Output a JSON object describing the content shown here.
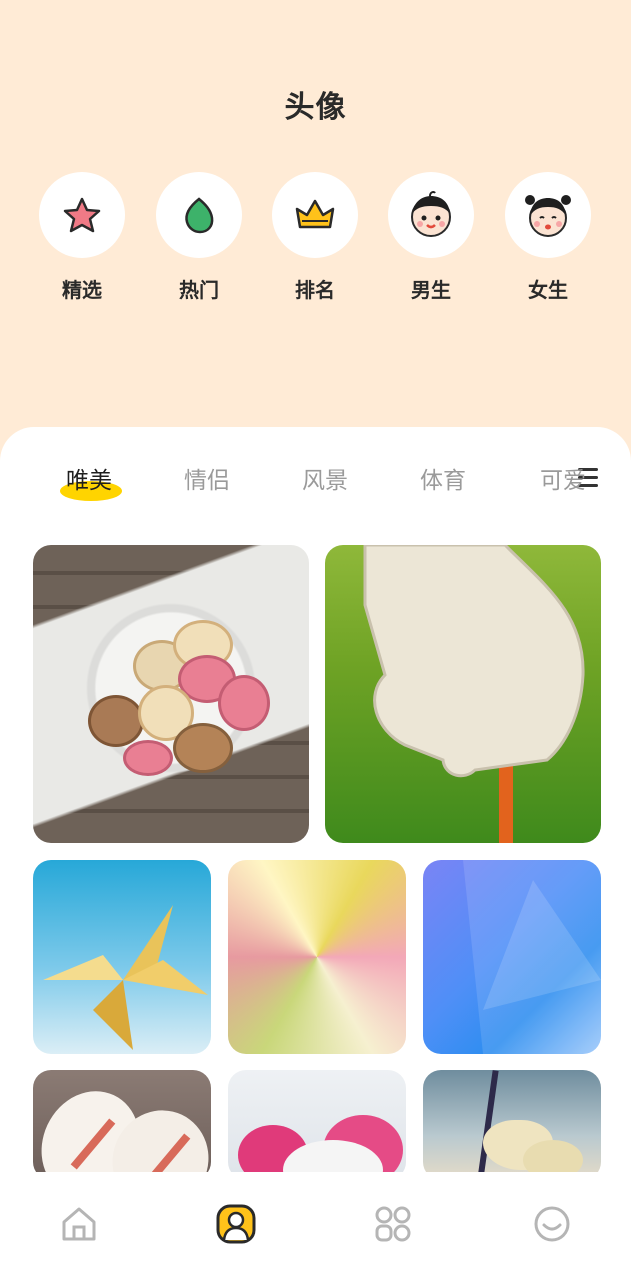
{
  "header": {
    "title": "头像"
  },
  "categories": [
    {
      "label": "精选",
      "icon": "star-icon"
    },
    {
      "label": "热门",
      "icon": "leaf-icon"
    },
    {
      "label": "排名",
      "icon": "crown-icon"
    },
    {
      "label": "男生",
      "icon": "boy-face-icon"
    },
    {
      "label": "女生",
      "icon": "girl-face-icon"
    }
  ],
  "tabs": [
    {
      "label": "唯美",
      "active": true
    },
    {
      "label": "情侣",
      "active": false
    },
    {
      "label": "风景",
      "active": false
    },
    {
      "label": "体育",
      "active": false
    },
    {
      "label": "可爱",
      "active": false
    }
  ],
  "gallery": [
    {
      "subject": "macarons-in-bowl"
    },
    {
      "subject": "golf-glove-ball"
    },
    {
      "subject": "pinwheel"
    },
    {
      "subject": "hexagon-pattern"
    },
    {
      "subject": "blue-gradient"
    },
    {
      "subject": "macarons"
    },
    {
      "subject": "pink-heart-snow"
    },
    {
      "subject": "flowers"
    }
  ],
  "bottom_nav": [
    {
      "icon": "home-icon",
      "active": false
    },
    {
      "icon": "avatar-icon",
      "active": true
    },
    {
      "icon": "apps-grid-icon",
      "active": false
    },
    {
      "icon": "smile-icon",
      "active": false
    }
  ],
  "colors": {
    "background": "#FFEBD6",
    "accent": "#FFD400",
    "active_text": "#1e1e1e",
    "inactive_text": "#9a9a9a"
  }
}
